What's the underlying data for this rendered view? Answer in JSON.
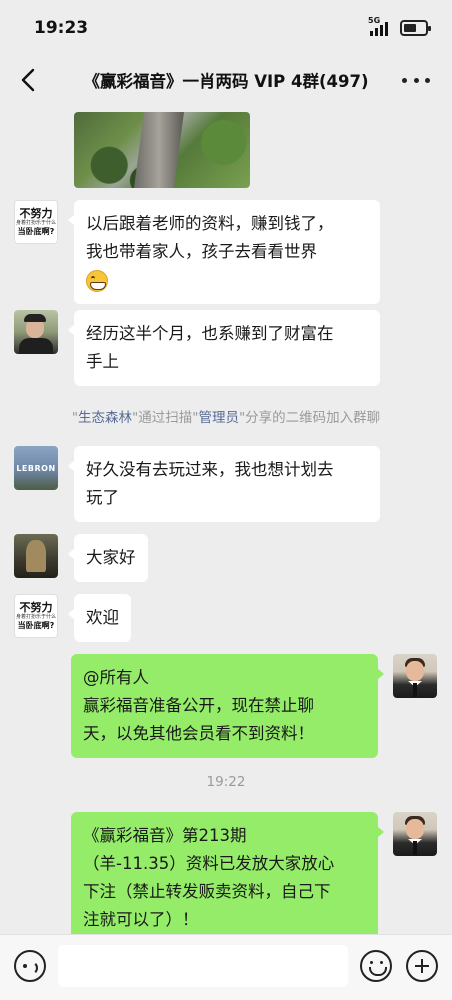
{
  "status_bar": {
    "time": "19:23",
    "network": "5G",
    "battery_percent": 60
  },
  "header": {
    "title": "《赢彩福音》一肖两码 VIP 4群(497)"
  },
  "messages": [
    {
      "type": "image",
      "side": "left",
      "alt": ""
    },
    {
      "type": "text",
      "side": "left",
      "avatar": "avatar-text",
      "lines": [
        "以后跟着老师的资料，赚到钱了，",
        "我也带着家人，孩子去看看世界"
      ],
      "emoji": "grin-emoji"
    },
    {
      "type": "text",
      "side": "left",
      "avatar": "avatar-guy",
      "lines": [
        "经历这半个月，也系赚到了财富在",
        "手上"
      ]
    },
    {
      "type": "system",
      "parts": [
        "\"",
        "生态森林",
        "\"通过扫描\"",
        "管理员",
        "\"分享的二维码加入群聊"
      ]
    },
    {
      "type": "text",
      "side": "left",
      "avatar": "avatar-lebron",
      "lines": [
        "好久没有去玩过来，我也想计划去",
        "玩了"
      ]
    },
    {
      "type": "text",
      "side": "left",
      "avatar": "avatar-statue",
      "lines": [
        "大家好"
      ]
    },
    {
      "type": "text",
      "side": "left",
      "avatar": "avatar-text",
      "lines": [
        "欢迎"
      ]
    },
    {
      "type": "text",
      "side": "right",
      "avatar": "avatar-man",
      "lines": [
        "@所有人",
        "赢彩福音准备公开，现在禁止聊",
        "天，以免其他会员看不到资料！"
      ]
    },
    {
      "type": "time",
      "text": "19:22"
    },
    {
      "type": "text",
      "side": "right",
      "avatar": "avatar-man",
      "lines": [
        "《赢彩福音》第213期",
        "（羊-11.35）资料已发放大家放心",
        "下注（禁止转发贩卖资料，自己下",
        "注就可以了）！"
      ]
    }
  ],
  "avatar_text": {
    "line1": "不努力",
    "line2": "身着打扮乐于什么",
    "line3": "当卧底啊?"
  },
  "avatar_lebron": {
    "label": "LEBRON"
  },
  "input_bar": {
    "placeholder": ""
  },
  "colors": {
    "background": "#ededed",
    "bubble_self": "#95ec69",
    "bubble_other": "#ffffff",
    "link": "#576b95"
  }
}
